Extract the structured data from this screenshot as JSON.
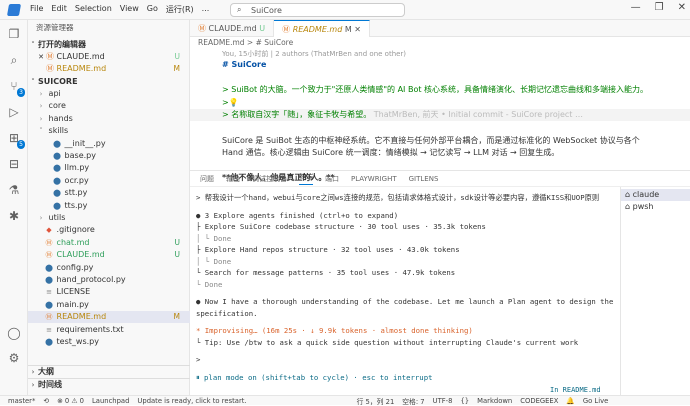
{
  "titlebar": {
    "menus": [
      "File",
      "Edit",
      "Selection",
      "View",
      "Go",
      "运行(R)",
      "..."
    ],
    "search": "SuiCore",
    "winbtns": [
      "—",
      "❐",
      "✕"
    ]
  },
  "activity": {
    "items": [
      "files-icon",
      "search-icon",
      "source-control-icon",
      "run-debug-icon",
      "extensions-icon",
      "remote-icon",
      "test-icon",
      "chat-icon"
    ],
    "badges": {
      "source_control": "3",
      "extensions": "5"
    }
  },
  "sidebar": {
    "title": "资源管理器",
    "open_editors": "打开的编辑器",
    "open": [
      {
        "name": "CLAUDE.md",
        "status": "U"
      },
      {
        "name": "README.md",
        "status": "M"
      }
    ],
    "project": "SUICORE",
    "files": [
      {
        "name": "api",
        "type": "folder",
        "status": ""
      },
      {
        "name": "core",
        "type": "folder",
        "status": ""
      },
      {
        "name": "hands",
        "type": "folder",
        "status": ""
      },
      {
        "name": "skills",
        "type": "folder",
        "status": ""
      },
      {
        "name": "__init__.py",
        "type": "py",
        "status": ""
      },
      {
        "name": "base.py",
        "type": "py",
        "status": ""
      },
      {
        "name": "llm.py",
        "type": "py",
        "status": ""
      },
      {
        "name": "ocr.py",
        "type": "py",
        "status": ""
      },
      {
        "name": "stt.py",
        "type": "py",
        "status": ""
      },
      {
        "name": "tts.py",
        "type": "py",
        "status": ""
      },
      {
        "name": "utils",
        "type": "folder",
        "status": ""
      },
      {
        "name": ".gitignore",
        "type": "git",
        "status": ""
      },
      {
        "name": "chat.md",
        "type": "md",
        "status": "U"
      },
      {
        "name": "CLAUDE.md",
        "type": "md",
        "status": "U"
      },
      {
        "name": "config.py",
        "type": "py",
        "status": ""
      },
      {
        "name": "hand_protocol.py",
        "type": "py",
        "status": ""
      },
      {
        "name": "LICENSE",
        "type": "txt",
        "status": ""
      },
      {
        "name": "main.py",
        "type": "py",
        "status": ""
      },
      {
        "name": "README.md",
        "type": "md",
        "status": "M"
      },
      {
        "name": "requirements.txt",
        "type": "txt",
        "status": ""
      },
      {
        "name": "test_ws.py",
        "type": "py",
        "status": ""
      }
    ],
    "outline": "大纲",
    "timeline": "时间线"
  },
  "editor": {
    "tabs": [
      {
        "label": "CLAUDE.md",
        "status": "U"
      },
      {
        "label": "README.md",
        "status": "M"
      }
    ],
    "breadcrumb": "README.md > # SuiCore",
    "blame": "You, 15小时前 | 2 authors (ThatMrBen and one other)",
    "lines": [
      {
        "num": "1",
        "text": "# SuiCore"
      },
      {
        "num": "2",
        "text": ""
      },
      {
        "num": "3",
        "text": "> SuiBot 的大脑。一个致力于\"还原人类情感\"的 AI Bot 核心系统，具备情绪演化、长期记忆遗忘曲线和多端接入能力。"
      },
      {
        "num": "4",
        "text": ">💡"
      },
      {
        "num": "5",
        "text": "> 名称取自汉字「随」，象征卡牧与希望。",
        "ghost": "ThatMrBen, 前天 • Initial commit - SuiCore project …"
      },
      {
        "num": "6",
        "text": ""
      },
      {
        "num": "7",
        "text": "SuiCore 是 SuiBot 生态的中枢神经系统。它不直接与任何外部平台耦合，而是通过标准化的 WebSocket 协议与各个"
      },
      {
        "num": "8",
        "text": "Hand 通信。核心逻辑由 SuiCore 统一调度：情绪模拟 → 记忆读写 → LLM 对话 → 回复生成。"
      },
      {
        "num": "9",
        "text": ""
      },
      {
        "num": "10",
        "text": "**他不像人，他是真正的人。**"
      }
    ]
  },
  "panel": {
    "tabs": [
      "问题",
      "输出",
      "调试控制台",
      "终端",
      "端口",
      "PLAYWRIGHT",
      "GITLENS"
    ],
    "active_tab": "终端",
    "term": [
      "> 帮我设计一个hand，webui与core之间ws连接的规范，包括请求体格式设计，sdk设计等必要内容，遵循KISS和UOP原则",
      "",
      "● 3 Explore agents finished (ctrl+o to expand)",
      "  ├ Explore SuiCore codebase structure · 30 tool uses · 35.3k tokens",
      "  │ └ Done",
      "  ├ Explore Hand repos structure · 32 tool uses · 43.0k tokens",
      "  │ └ Done",
      "  └ Search for message patterns · 35 tool uses · 47.9k tokens",
      "    └ Done",
      "",
      "● Now I have a thorough understanding of the codebase. Let me launch a Plan agent to design the",
      "  specification.",
      "",
      "* Improvising… (16m 25s · ↓ 9.9k tokens · almost done thinking)",
      "  └ Tip: Use /btw to ask a quick side question without interrupting Claude's current work",
      "",
      ">",
      "",
      "⏸ plan mode on (shift+tab to cycle) · esc to interrupt"
    ],
    "in_file": "In README.md",
    "terminals": [
      "claude",
      "pwsh"
    ]
  },
  "status": {
    "branch": "master*",
    "sync": "⟲",
    "errors": "⊗ 0 ⚠ 0",
    "launchpad": "Launchpad",
    "update": "Update is ready, click to restart.",
    "pos": "行 5，列 21",
    "spaces": "空格: 7",
    "enc": "UTF-8",
    "eol": "{}",
    "lang": "Markdown",
    "codegeex": "CODEGEEX",
    "bell": "🔔",
    "golive": "Go Live"
  }
}
